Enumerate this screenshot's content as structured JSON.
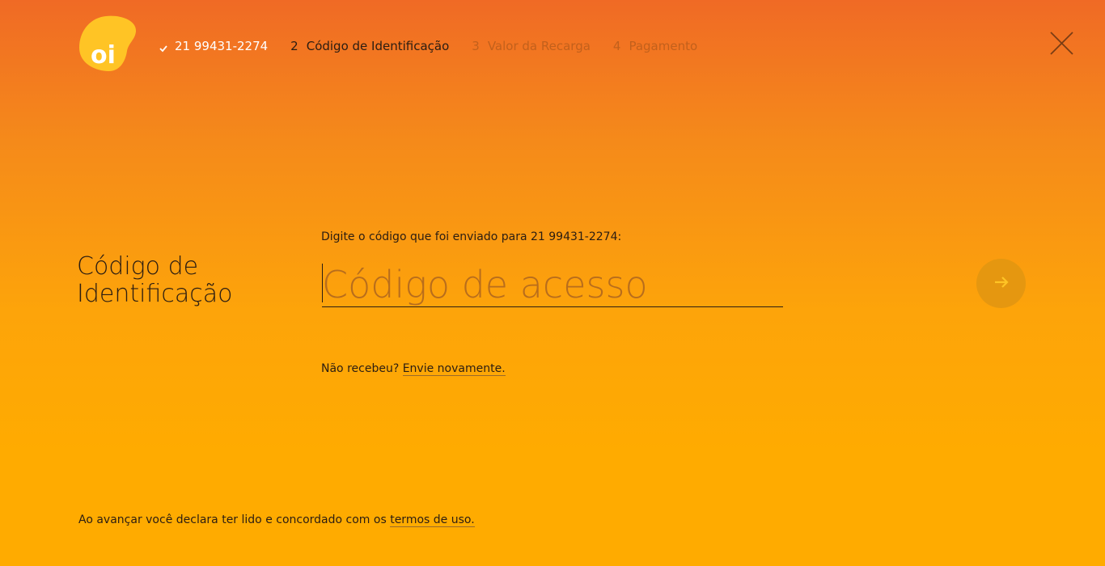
{
  "brand": {
    "logo_text": "oi"
  },
  "steps": [
    {
      "number": "",
      "label": "21 99431-2274",
      "state": "done",
      "icon": "check-icon"
    },
    {
      "number": "2",
      "label": "Código de Identificação",
      "state": "current"
    },
    {
      "number": "3",
      "label": "Valor da Recarga",
      "state": "pending"
    },
    {
      "number": "4",
      "label": "Pagamento",
      "state": "pending"
    }
  ],
  "header": {
    "close_icon": "close-icon"
  },
  "main": {
    "section_title": "Código de Identificação",
    "prompt": "Digite o código que foi enviado para 21 99431-2274:",
    "code_input": {
      "value": "",
      "placeholder": "Código de acesso"
    },
    "next_button_icon": "arrow-right-icon",
    "resend_text": "Não recebeu?",
    "resend_link": "Envie novamente."
  },
  "footer": {
    "terms_text": "Ao avançar você declara ter lido e concordado com os",
    "terms_link": "termos de uso."
  },
  "colors": {
    "gradient_top": "#f06a25",
    "gradient_bottom": "#ffab00",
    "text": "#2b1d12",
    "logo_yellow": "#ffc425",
    "next_button": "#e59710"
  }
}
